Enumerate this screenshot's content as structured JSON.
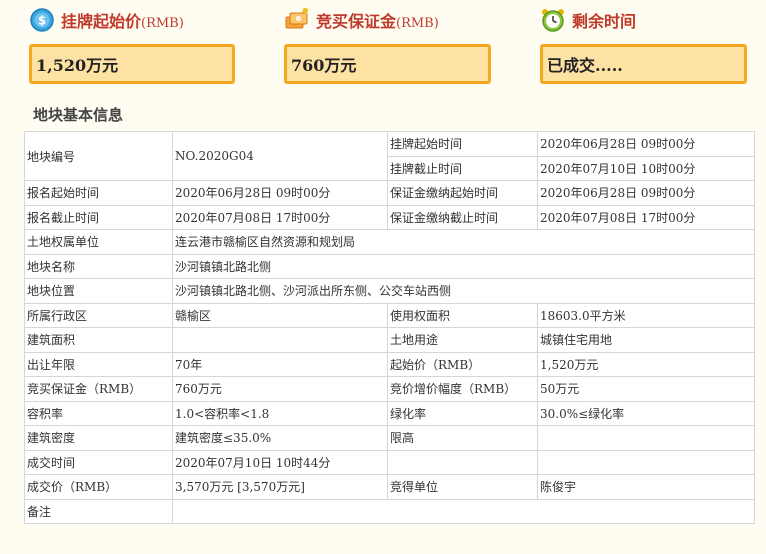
{
  "stats": [
    {
      "icon": "dollar-coin-icon",
      "label": "挂牌起始价",
      "unit": "(RMB)",
      "value": "1,520万元"
    },
    {
      "icon": "money-stack-icon",
      "label": "竞买保证金",
      "unit": "(RMB)",
      "value": "760万元"
    },
    {
      "icon": "alarm-clock-icon",
      "label": "剩余时间",
      "unit": "",
      "value": "已成交....."
    }
  ],
  "section_title": "地块基本信息",
  "rows": {
    "r1": {
      "l1": "地块编号",
      "v1": "NO.2020G04",
      "l2": "挂牌起始时间",
      "v2": "2020年06月28日 09时00分"
    },
    "r2": {
      "l2": "挂牌截止时间",
      "v2": "2020年07月10日 10时00分"
    },
    "r3": {
      "l1": "报名起始时间",
      "v1": "2020年06月28日 09时00分",
      "l2": "保证金缴纳起始时间",
      "v2": "2020年06月28日 09时00分"
    },
    "r4": {
      "l1": "报名截止时间",
      "v1": "2020年07月08日 17时00分",
      "l2": "保证金缴纳截止时间",
      "v2": "2020年07月08日 17时00分"
    },
    "r5": {
      "l1": "土地权属单位",
      "v1": "连云港市赣榆区自然资源和规划局"
    },
    "r6": {
      "l1": "地块名称",
      "v1": "沙河镇镇北路北侧"
    },
    "r7": {
      "l1": "地块位置",
      "v1": "沙河镇镇北路北侧、沙河派出所东侧、公交车站西侧"
    },
    "r8": {
      "l1": "所属行政区",
      "v1": "赣榆区",
      "l2": "使用权面积",
      "v2": "18603.0平方米"
    },
    "r9": {
      "l1": "建筑面积",
      "v1": "",
      "l2": "土地用途",
      "v2": "城镇住宅用地"
    },
    "r10": {
      "l1": "出让年限",
      "v1": "70年",
      "l2": "起始价（RMB）",
      "v2": "1,520万元"
    },
    "r11": {
      "l1": "竞买保证金（RMB）",
      "v1": "760万元",
      "l2": "竞价增价幅度（RMB）",
      "v2": "50万元"
    },
    "r12": {
      "l1": "容积率",
      "v1": "1.0<容积率<1.8",
      "l2": "绿化率",
      "v2": "30.0%≤绿化率"
    },
    "r13": {
      "l1": "建筑密度",
      "v1": "建筑密度≤35.0%",
      "l2": "限高",
      "v2": ""
    },
    "r14": {
      "l1": "成交时间",
      "v1": "2020年07月10日 10时44分",
      "l2": "",
      "v2": ""
    },
    "r15": {
      "l1": "成交价（RMB）",
      "v1": "3,570万元 [3,570万元]",
      "l2": "竞得单位",
      "v2": "陈俊宇"
    },
    "r16": {
      "l1": "备注",
      "v1": ""
    }
  }
}
